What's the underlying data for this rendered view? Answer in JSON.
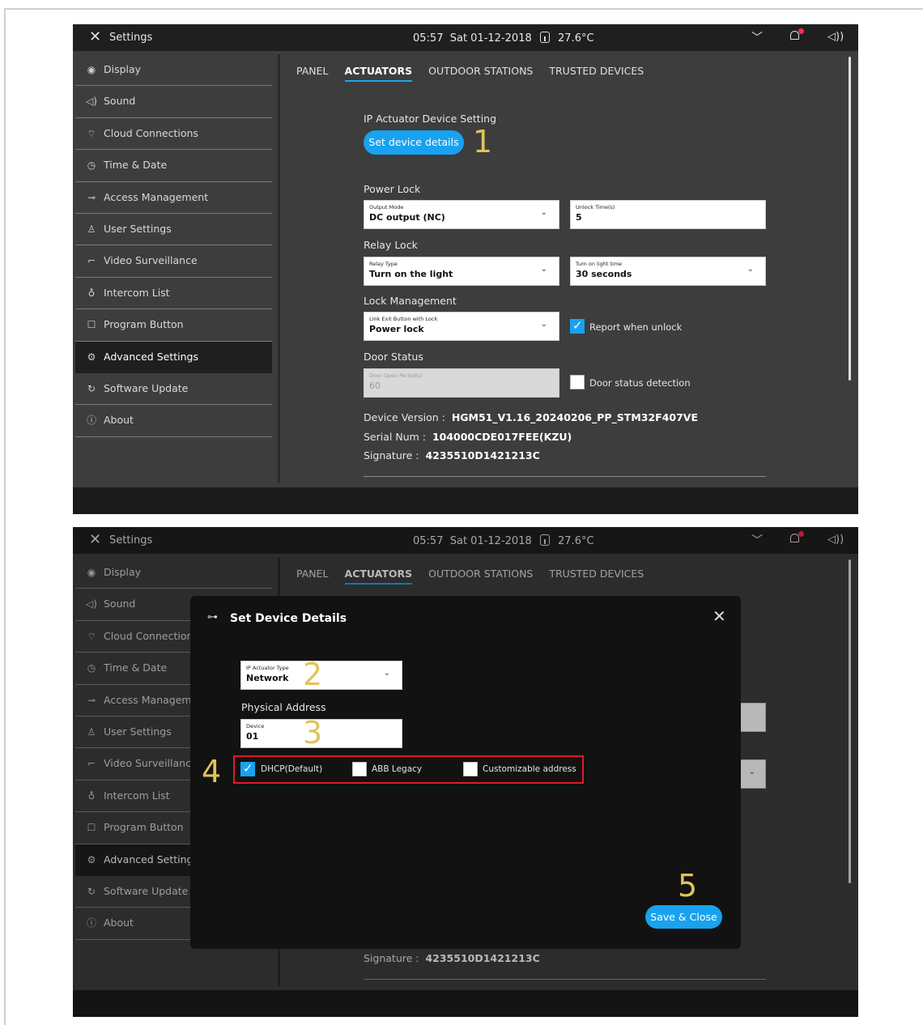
{
  "topbar": {
    "title": "Settings",
    "time": "05:57",
    "date": "Sat 01-12-2018",
    "temperature": "27.6°C"
  },
  "sidebar": {
    "items": [
      {
        "label": "Display",
        "icon": "eye-icon"
      },
      {
        "label": "Sound",
        "icon": "speaker-icon"
      },
      {
        "label": "Cloud Connections",
        "icon": "wifi-icon"
      },
      {
        "label": "Time & Date",
        "icon": "clock-calendar-icon"
      },
      {
        "label": "Access Management",
        "icon": "key-icon"
      },
      {
        "label": "User Settings",
        "icon": "user-icon"
      },
      {
        "label": "Video Surveillance",
        "icon": "camera-icon"
      },
      {
        "label": "Intercom List",
        "icon": "microphone-icon"
      },
      {
        "label": "Program Button",
        "icon": "square-icon"
      },
      {
        "label": "Advanced Settings",
        "icon": "gear-icon",
        "active": true
      },
      {
        "label": "Software Update",
        "icon": "refresh-icon"
      },
      {
        "label": "About",
        "icon": "info-icon"
      }
    ]
  },
  "tabs": [
    "PANEL",
    "ACTUATORS",
    "OUTDOOR STATIONS",
    "TRUSTED DEVICES"
  ],
  "actuators": {
    "ip_heading": "IP Actuator Device Setting",
    "set_details_button": "Set device details",
    "power_lock_heading": "Power Lock",
    "output_mode": {
      "label": "Output Mode",
      "value": "DC output (NC)"
    },
    "unlock_time": {
      "label": "Unlock Time(s)",
      "value": "5"
    },
    "relay_lock_heading": "Relay Lock",
    "relay_type": {
      "label": "Relay Type",
      "value": "Turn on the light"
    },
    "light_time": {
      "label": "Turn on light time",
      "value": "30 seconds"
    },
    "lock_mgmt_heading": "Lock Management",
    "link_exit": {
      "label": "Link Exit Button with Lock",
      "value": "Power lock"
    },
    "report_unlock": {
      "label": "Report when unlock",
      "checked": true
    },
    "door_status_heading": "Door Status",
    "door_open_period": {
      "label": "Door Open Period(s)",
      "value": "60"
    },
    "door_status_detection": {
      "label": "Door status detection",
      "checked": false
    },
    "device_version_label": "Device Version :",
    "device_version": "HGM51_V1.16_20240206_PP_STM32F407VE",
    "serial_label": "Serial Num :",
    "serial": "104000CDE017FEE(KZU)",
    "signature_label": "Signature :",
    "signature": "4235510D1421213C"
  },
  "modal": {
    "title": "Set Device Details",
    "actuator_type": {
      "label": "IP Actuator Type",
      "value": "Network"
    },
    "physical_address": "Physical Address",
    "device": {
      "label": "Device",
      "value": "01"
    },
    "options": [
      {
        "label": "DHCP(Default)",
        "checked": true
      },
      {
        "label": "ABB Legacy",
        "checked": false
      },
      {
        "label": "Customizable address",
        "checked": false
      }
    ],
    "save_button": "Save & Close"
  },
  "steps": [
    "1",
    "2",
    "3",
    "4",
    "5"
  ],
  "colors": {
    "accent": "#18a2ef",
    "step": "#e2c35a",
    "highlight": "#e0192a"
  }
}
